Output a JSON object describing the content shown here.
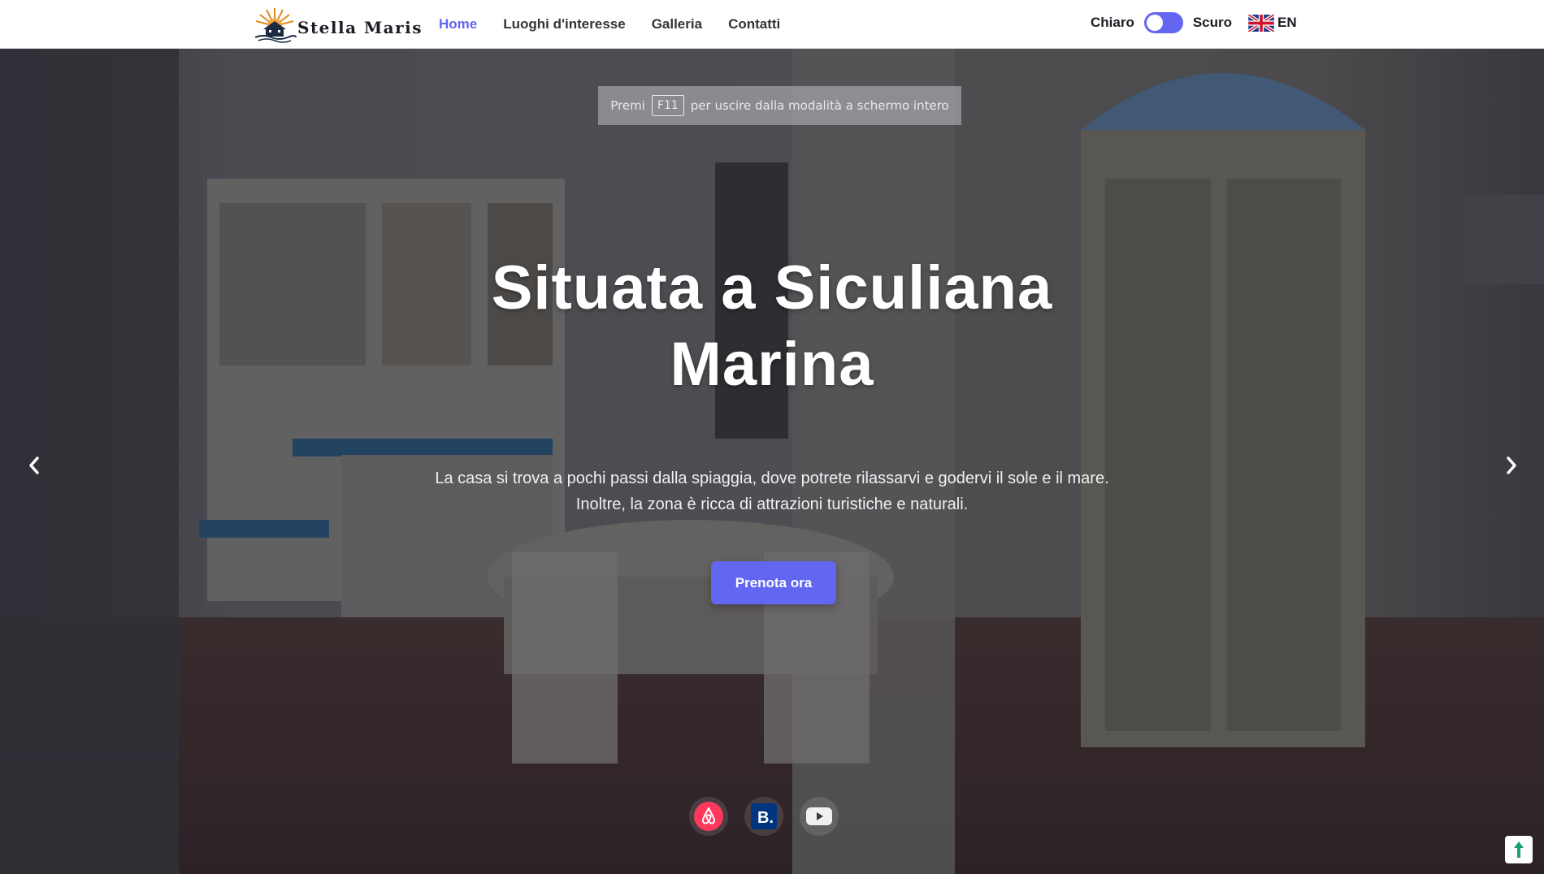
{
  "brand": {
    "name": "Stella Maris",
    "logo_icon": "sunset-house-logo"
  },
  "nav": {
    "items": [
      {
        "label": "Home",
        "active": true
      },
      {
        "label": "Luoghi d'interesse",
        "active": false
      },
      {
        "label": "Galleria",
        "active": false
      },
      {
        "label": "Contatti",
        "active": false
      }
    ]
  },
  "theme": {
    "light_label": "Chiaro",
    "dark_label": "Scuro",
    "toggle_on": true
  },
  "language": {
    "code": "EN",
    "flag_icon": "uk-flag-icon"
  },
  "fullscreen_hint": {
    "before": "Premi",
    "key": "F11",
    "after": "per uscire dalla modalità a schermo intero"
  },
  "hero": {
    "title_line1": "Situata a Siculiana",
    "title_line2": "Marina",
    "subtitle_line1": "La casa si trova a pochi passi dalla spiaggia, dove potrete rilassarvi e godervi il sole e il mare.",
    "subtitle_line2": "Inoltre, la zona è ricca di attrazioni turistiche e naturali.",
    "cta_label": "Prenota ora"
  },
  "carousel": {
    "prev_icon": "chevron-left-icon",
    "next_icon": "chevron-right-icon"
  },
  "socials": [
    {
      "name": "airbnb-icon"
    },
    {
      "name": "booking-icon",
      "label": "B."
    },
    {
      "name": "youtube-icon"
    }
  ],
  "colors": {
    "accent": "#6366f1",
    "navbar_bg": "#ffffff",
    "nav_text": "#33333a"
  }
}
